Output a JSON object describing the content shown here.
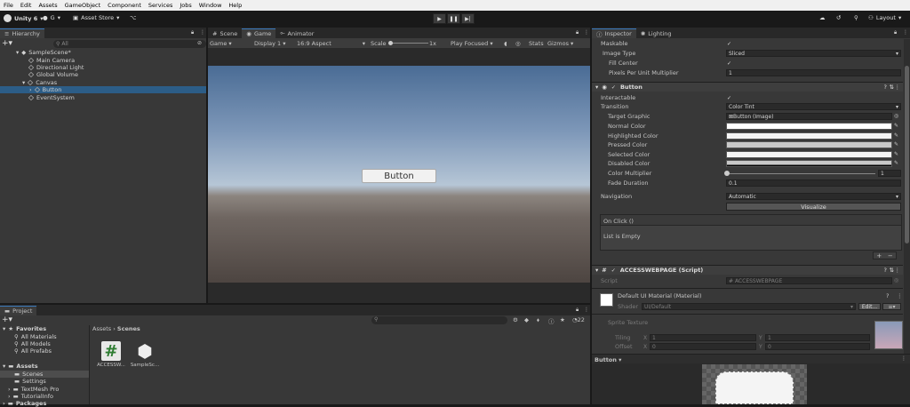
{
  "menu": [
    "File",
    "Edit",
    "Assets",
    "GameObject",
    "Component",
    "Services",
    "Jobs",
    "Window",
    "Help"
  ],
  "toolbar": {
    "app_label": "Unity 6",
    "account_label": "G",
    "asset_store_label": "Asset Store",
    "layout_label": "Layout"
  },
  "hierarchy": {
    "tab": "Hierarchy",
    "search_placeholder": "All",
    "items": [
      {
        "label": "SampleScene*",
        "indent": 0
      },
      {
        "label": "Main Camera",
        "indent": 1
      },
      {
        "label": "Directional Light",
        "indent": 1
      },
      {
        "label": "Global Volume",
        "indent": 1
      },
      {
        "label": "Canvas",
        "indent": 1
      },
      {
        "label": "Button",
        "indent": 2
      },
      {
        "label": "EventSystem",
        "indent": 1
      }
    ]
  },
  "game_view": {
    "tabs": [
      "Scene",
      "Game",
      "Animator"
    ],
    "controls": {
      "mode": "Game",
      "display": "Display 1",
      "aspect": "16:9 Aspect",
      "scale_label": "Scale",
      "scale_value": "1x",
      "play_focus": "Play Focused",
      "stats": "Stats",
      "gizmos": "Gizmos"
    },
    "button_text": "Button"
  },
  "inspector": {
    "tabs": [
      "Inspector",
      "Lighting"
    ],
    "image_rows": [
      {
        "label": "Maskable",
        "value": "✓",
        "type": "check"
      },
      {
        "label": "Image Type",
        "value": "Sliced",
        "type": "dropdown"
      },
      {
        "label": "Fill Center",
        "value": "✓",
        "type": "check"
      },
      {
        "label": "Pixels Per Unit Multiplier",
        "value": "1",
        "type": "field"
      }
    ],
    "button_header": "Button",
    "button_rows": [
      {
        "label": "Interactable",
        "value": "✓",
        "type": "check"
      },
      {
        "label": "Transition",
        "value": "Color Tint",
        "type": "dropdown"
      },
      {
        "label": "Target Graphic",
        "value": "Button (Image)",
        "type": "field"
      },
      {
        "label": "Normal Color",
        "value": "",
        "type": "color"
      },
      {
        "label": "Highlighted Color",
        "value": "",
        "type": "color"
      },
      {
        "label": "Pressed Color",
        "value": "",
        "type": "color"
      },
      {
        "label": "Selected Color",
        "value": "",
        "type": "color"
      },
      {
        "label": "Disabled Color",
        "value": "",
        "type": "color"
      },
      {
        "label": "Color Multiplier",
        "value": "1",
        "type": "slider"
      },
      {
        "label": "Fade Duration",
        "value": "0.1",
        "type": "field"
      }
    ],
    "navigation_label": "Navigation",
    "navigation_value": "Automatic",
    "visualize_label": "Visualize",
    "onclick_label": "On Click ()",
    "list_empty": "List is Empty",
    "script_header": "ACCESSWEBPAGE (Script)",
    "script_label": "Script",
    "script_value": "ACCESSWEBPAGE",
    "material_name": "Default UI Material (Material)",
    "shader_label": "Shader",
    "shader_value": "UI/Default",
    "edit_label": "Edit...",
    "sprite_texture_label": "Sprite Texture",
    "tiling_label": "Tiling",
    "offset_label": "Offset",
    "tiling": {
      "x": "1",
      "y": "1"
    },
    "offset": {
      "x": "0",
      "y": "0"
    },
    "preview_label": "Button"
  },
  "project": {
    "tab": "Project",
    "favorites_label": "Favorites",
    "favorites": [
      "All Materials",
      "All Models",
      "All Prefabs"
    ],
    "assets_label": "Assets",
    "folders": [
      "Scenes",
      "Settings",
      "TextMesh Pro",
      "TutorialInfo"
    ],
    "packages_label": "Packages",
    "breadcrumb": [
      "Assets",
      "Scenes"
    ],
    "files": [
      {
        "name": "ACCESSW...",
        "icon": "csharp-script-icon"
      },
      {
        "name": "SampleSc...",
        "icon": "unity-scene-icon"
      }
    ],
    "count": "22"
  },
  "colors": {
    "accent": "#3a79bb",
    "panel": "#383838",
    "dark": "#191919"
  }
}
